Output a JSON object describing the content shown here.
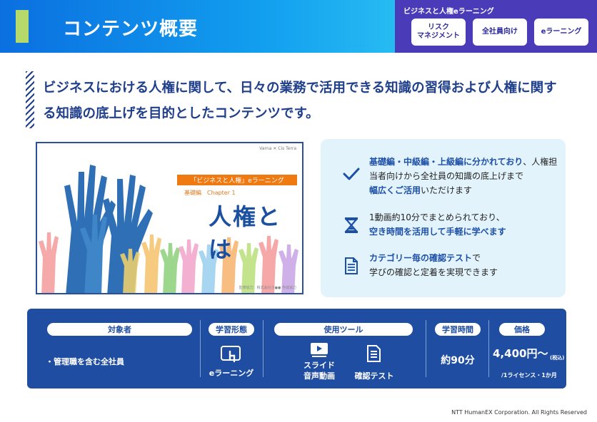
{
  "header": {
    "title": "コンテンツ概要",
    "panel_title": "ビジネスと人権eラーニング",
    "tags": [
      "リスク\nマネジメント",
      "全社員向け",
      "eラーニング"
    ]
  },
  "lead": "ビジネスにおける人権に関して、日々の業務で活用できる知識の習得および人権に関する知識の底上げを目的としたコンテンツです。",
  "thumbnail": {
    "logos": "Varna ✕ Cis Terra",
    "series_label": "「ビジネスと人権」eラーニング",
    "chapter": "基礎編　Chapter 1",
    "slide_title": "人権とは",
    "credit": "監修協力：株式会社ホ●● 作成協力"
  },
  "features": [
    {
      "icon": "checkmark-icon",
      "hl1": "基礎編・中級編・上級編に分かれており",
      "text1": "、人権担当者向けから全社員の知識の底上げまで",
      "hl2": "幅広くご活用",
      "text2": "いただけます"
    },
    {
      "icon": "hourglass-icon",
      "text1": "1動画約10分でまとめられており、",
      "hl1": "空き時間を活用して手軽に学べます"
    },
    {
      "icon": "document-icon",
      "hl1": "カテゴリー毎の確認テスト",
      "text1": "で",
      "text2": "学びの確認と定着を実現できます"
    }
  ],
  "info": {
    "target_label": "対象者",
    "target_value": "・管理職を含む全社員",
    "format_label": "学習形態",
    "format_value": "eラーニング",
    "tools_label": "使用ツール",
    "tool1": "スライド\n音声動画",
    "tool2": "確認テスト",
    "time_label": "学習時間",
    "time_value": "約90分",
    "price_label": "価格",
    "price_value": "4,400円〜",
    "price_tax": "(税込)",
    "price_unit": "/1ライセンス・1か月"
  },
  "footer": "NTT HumanEX Corporation. All Rights Reserved"
}
